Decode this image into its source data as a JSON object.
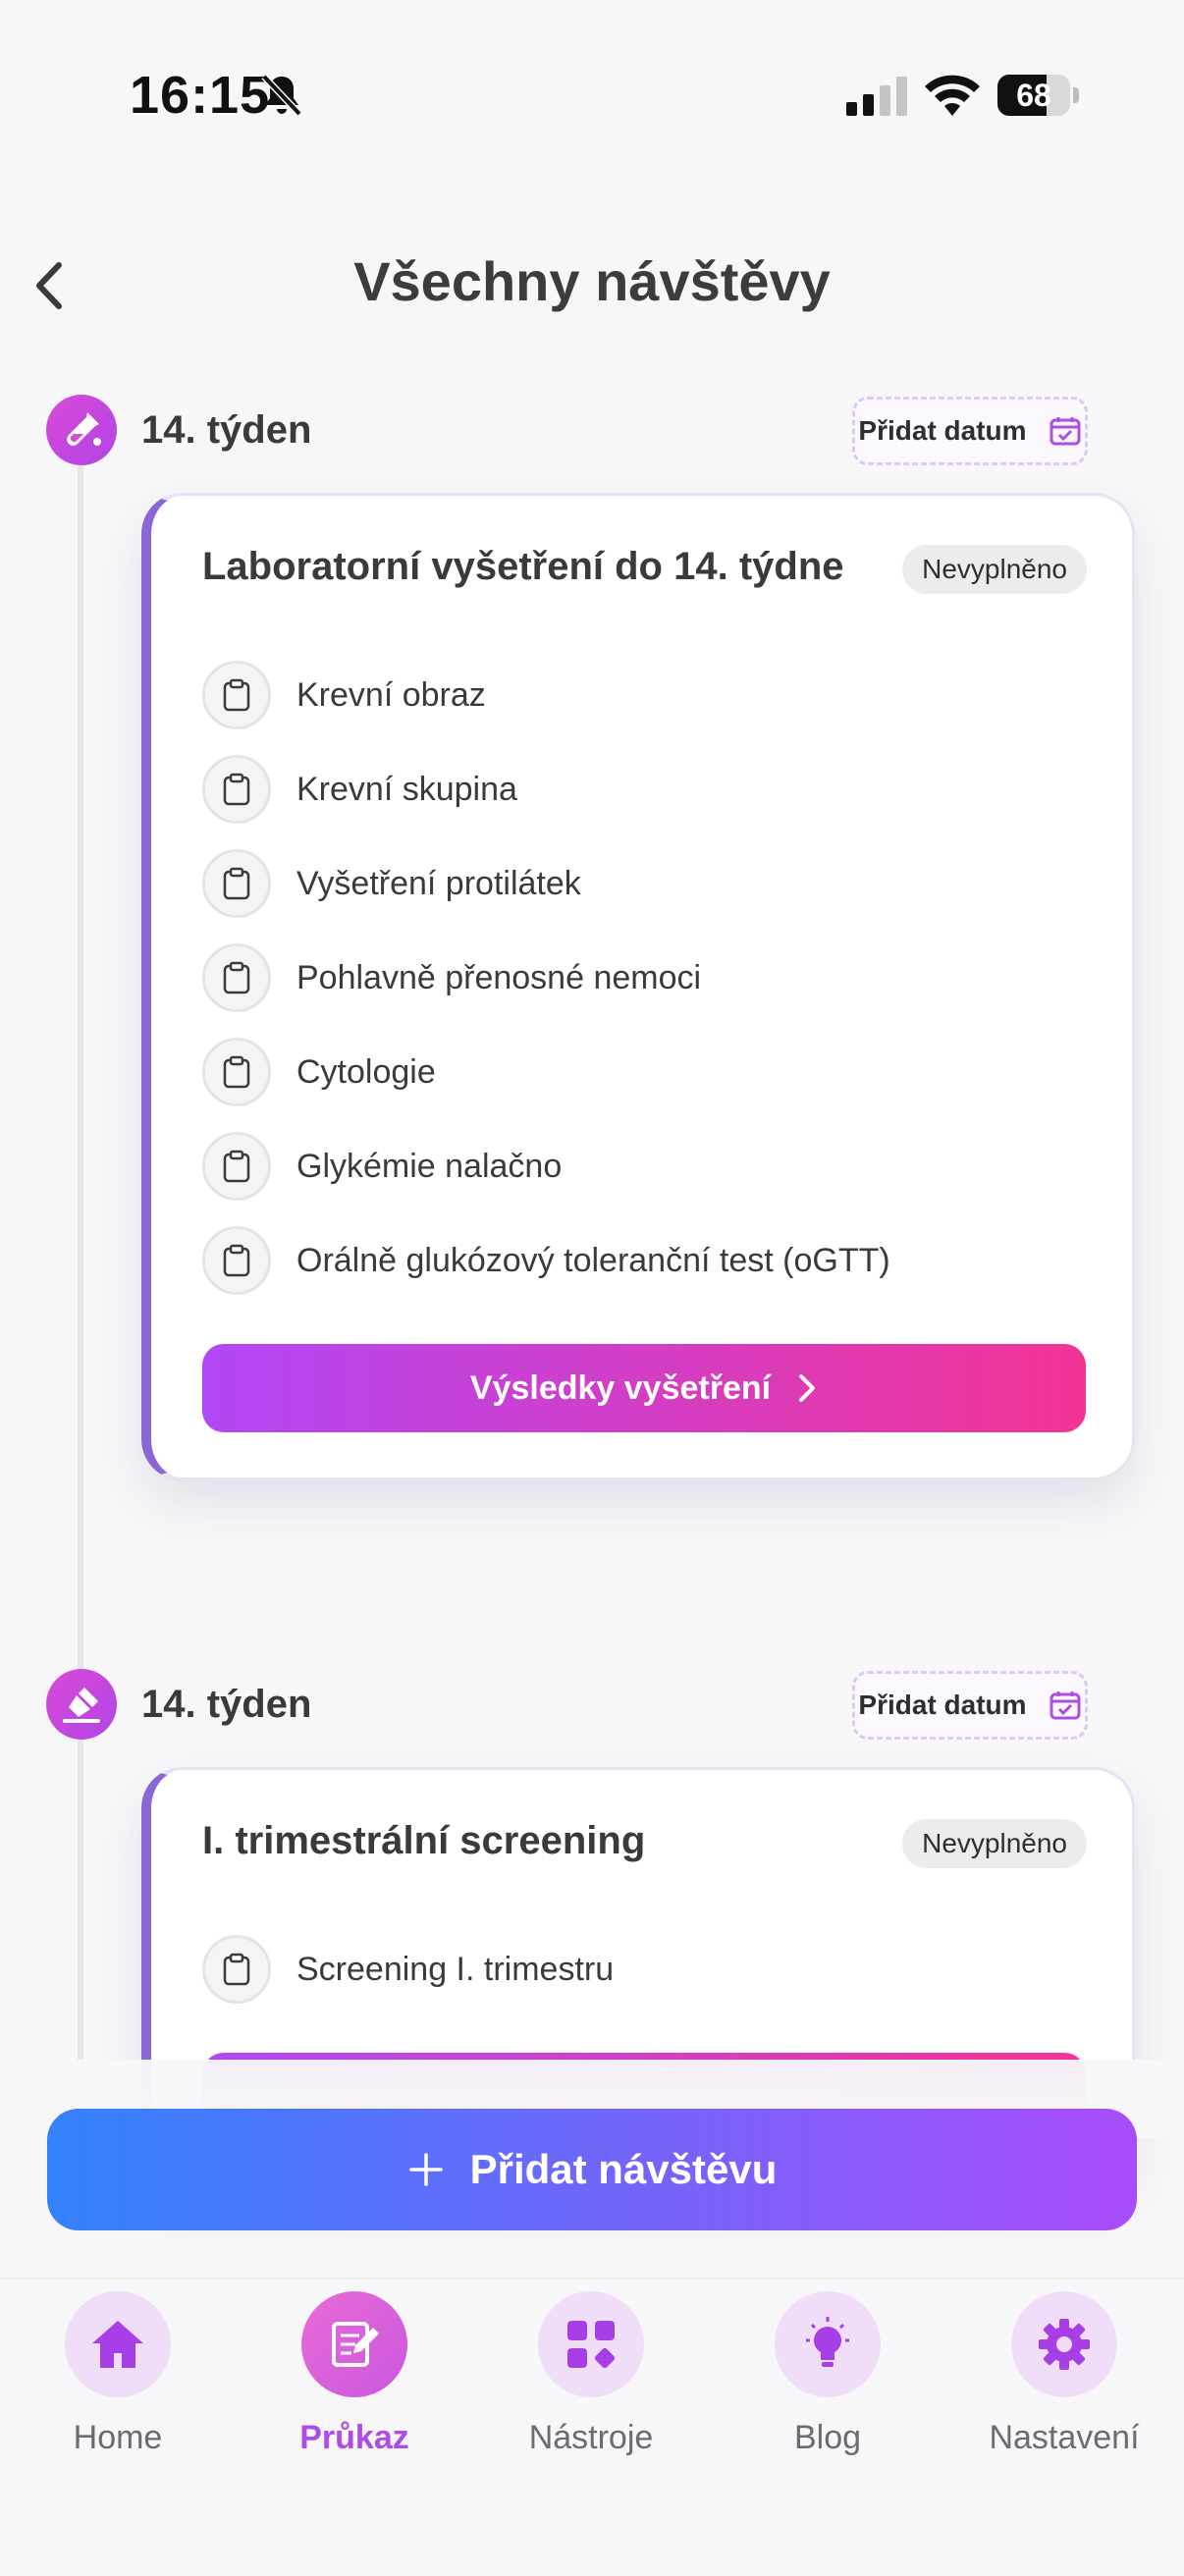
{
  "status_bar": {
    "time": "16:15",
    "battery": "68",
    "battery_level": 0.68
  },
  "header": {
    "title": "Všechny návštěvy"
  },
  "visits": [
    {
      "week": "14. týden",
      "add_date_label": "Přidat datum",
      "title": "Laboratorní vyšetření do 14. týdne",
      "status": "Nevyplněno",
      "items": [
        "Krevní obraz",
        "Krevní skupina",
        "Vyšetření protilátek",
        "Pohlavně přenosné nemoci",
        "Cytologie",
        "Glykémie nalačno",
        "Orálně glukózový toleranční test (oGTT)"
      ],
      "results_button": "Výsledky vyšetření"
    },
    {
      "week": "14. týden",
      "add_date_label": "Přidat datum",
      "title": "I. trimestrální screening",
      "status": "Nevyplněno",
      "items": [
        "Screening I. trimestru"
      ]
    }
  ],
  "add_visit_button": "Přidat návštěvu",
  "tabs": [
    {
      "label": "Home",
      "icon": "home-icon",
      "active": false
    },
    {
      "label": "Průkaz",
      "icon": "card-edit-icon",
      "active": true
    },
    {
      "label": "Nástroje",
      "icon": "tools-grid-icon",
      "active": false
    },
    {
      "label": "Blog",
      "icon": "lightbulb-icon",
      "active": false
    },
    {
      "label": "Nastavení",
      "icon": "gear-icon",
      "active": false
    }
  ],
  "colors": {
    "accent_purple": "#b04ce6",
    "pink": "#f33496",
    "blue": "#3382fc",
    "card_border": "#8b66d6"
  }
}
